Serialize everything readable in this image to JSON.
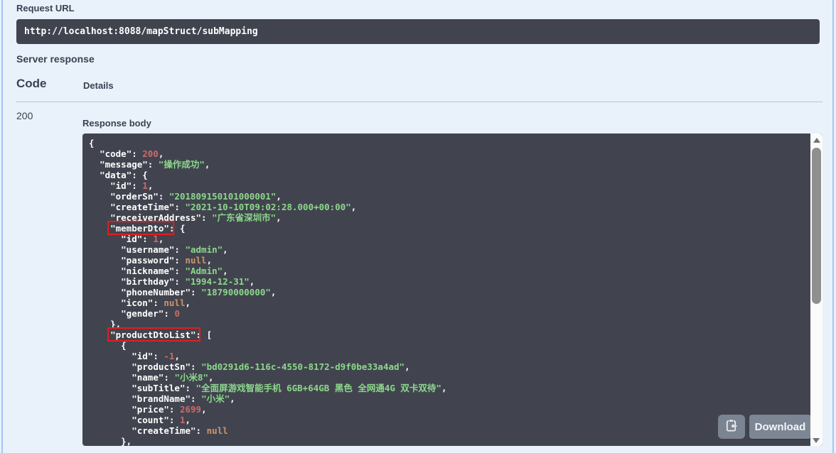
{
  "request_url": {
    "label": "Request URL",
    "value": "http://localhost:8088/mapStruct/subMapping"
  },
  "server_response": {
    "title": "Server response",
    "code_header": "Code",
    "details_header": "Details",
    "status_code": "200",
    "response_body_label": "Response body"
  },
  "response_body_lines": [
    "{",
    "  \"code\": 200,",
    "  \"message\": \"操作成功\",",
    "  \"data\": {",
    "    \"id\": 1,",
    "    \"orderSn\": \"201809150101000001\",",
    "    \"createTime\": \"2021-10-10T09:02:28.000+00:00\",",
    "    \"receiverAddress\": \"广东省深圳市\",",
    "    \"memberDto\": {",
    "      \"id\": 1,",
    "      \"username\": \"admin\",",
    "      \"password\": null,",
    "      \"nickname\": \"Admin\",",
    "      \"birthday\": \"1994-12-31\",",
    "      \"phoneNumber\": \"18790000000\",",
    "      \"icon\": null,",
    "      \"gender\": 0",
    "    },",
    "    \"productDtoList\": [",
    "      {",
    "        \"id\": -1,",
    "        \"productSn\": \"bd0291d6-116c-4550-8172-d9f0be33a4ad\",",
    "        \"name\": \"小米8\",",
    "        \"subTitle\": \"全面屏游戏智能手机 6GB+64GB 黑色 全网通4G 双卡双待\",",
    "        \"brandName\": \"小米\",",
    "        \"price\": 2699,",
    "        \"count\": 1,",
    "        \"createTime\": null",
    "      },"
  ],
  "annotations": [
    {
      "label": "memberDto"
    },
    {
      "label": "productDtoList"
    }
  ],
  "actions": {
    "copy_button_icon": "copy-to-clipboard-icon",
    "download_label": "Download"
  },
  "colors": {
    "page_background": "#e9f1fb",
    "header_text": "#3b4151",
    "code_background": "#41444e",
    "json_key": "#ffffff",
    "json_string": "#8cd88c",
    "json_number": "#cd6a6a",
    "json_null": "#d0946a",
    "annotation_box": "#e51c1c",
    "button_background": "#808a99"
  }
}
